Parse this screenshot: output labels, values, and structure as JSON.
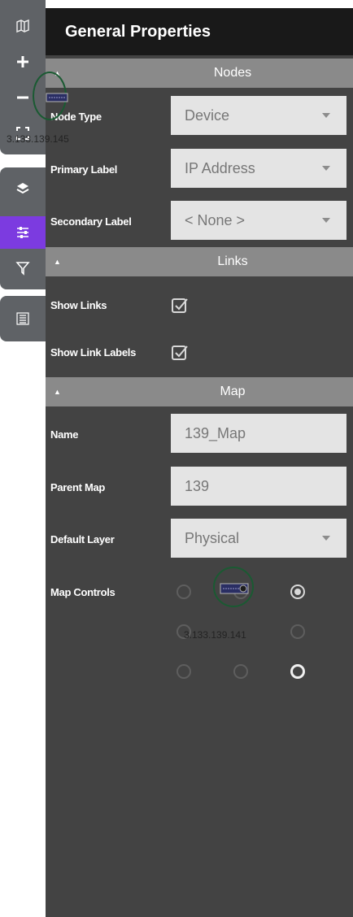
{
  "panel": {
    "title": "General Properties"
  },
  "toolbar": {
    "icons": [
      "map-icon",
      "zoom-in-icon",
      "zoom-out-icon",
      "fit-icon",
      "layers-icon",
      "properties-icon",
      "filter-icon",
      "list-icon"
    ],
    "active_color": "#7c3be0"
  },
  "sections": {
    "nodes": {
      "title": "Nodes",
      "node_type": {
        "label": "Node Type",
        "value": "Device"
      },
      "primary_label": {
        "label": "Primary Label",
        "value": "IP Address"
      },
      "secondary_label": {
        "label": "Secondary Label",
        "value": "< None >"
      }
    },
    "links": {
      "title": "Links",
      "show_links": {
        "label": "Show Links",
        "checked": true
      },
      "show_link_labels": {
        "label": "Show Link Labels",
        "checked": true
      }
    },
    "map": {
      "title": "Map",
      "name": {
        "label": "Name",
        "value": "139_Map"
      },
      "parent_map": {
        "label": "Parent Map",
        "value": "139"
      },
      "default_layer": {
        "label": "Default Layer",
        "value": "Physical"
      },
      "map_controls": {
        "label": "Map Controls",
        "selected_position": "top-right"
      }
    }
  },
  "overlays": {
    "ip_1": "3.133.139.145",
    "ip_2": "3.133.139.141"
  },
  "colors": {
    "panel_bg": "#434343",
    "header_bg": "#191919",
    "section_bg": "#8a8a8a",
    "field_bg": "#e4e4e4",
    "toolbar_bg": "#5f6266",
    "accent": "#7c3be0"
  }
}
